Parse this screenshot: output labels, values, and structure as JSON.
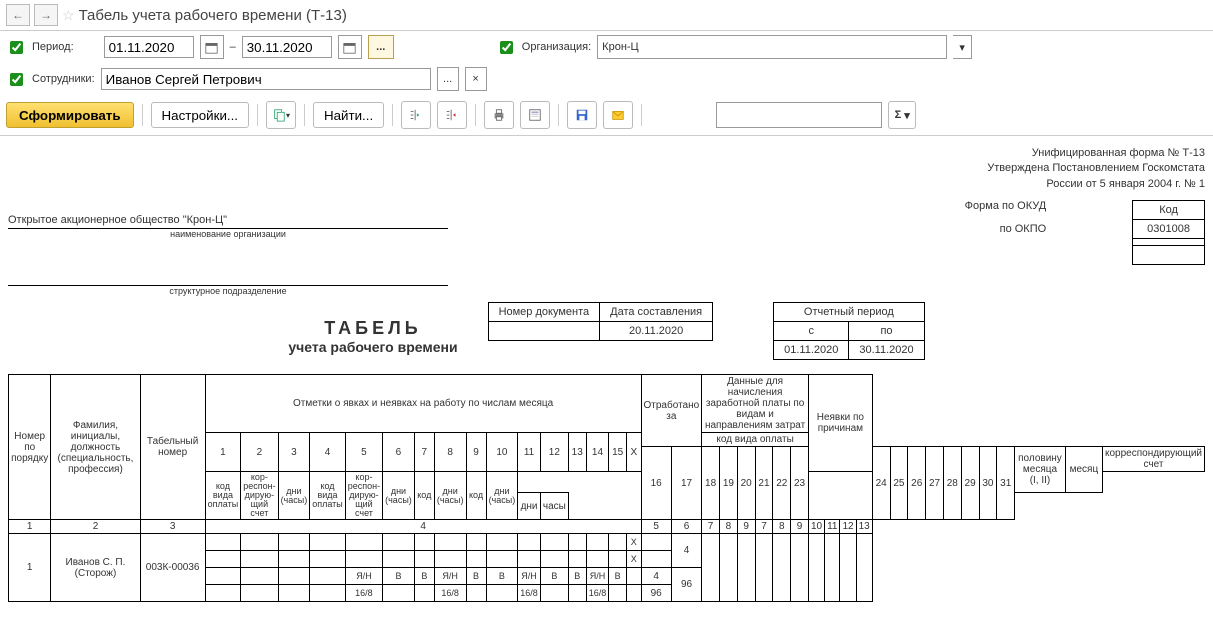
{
  "window": {
    "title": "Табель учета рабочего времени (Т-13)"
  },
  "filters": {
    "period_label": "Период:",
    "date_from": "01.11.2020",
    "date_to": "30.11.2020",
    "dash": "–",
    "org_label": "Организация:",
    "org_value": "Крон-Ц",
    "emp_label": "Сотрудники:",
    "emp_value": "Иванов Сергей Петрович"
  },
  "toolbar": {
    "generate": "Сформировать",
    "settings": "Настройки...",
    "find": "Найти...",
    "sigma": "Σ"
  },
  "report": {
    "form_hdr1": "Унифицированная форма № Т-13",
    "form_hdr2": "Утверждена Постановлением Госкомстата",
    "form_hdr3": "России от 5 января 2004 г. № 1",
    "code_label": "Код",
    "okud_label": "Форма по ОКУД",
    "okud": "0301008",
    "okpo_label": "по ОКПО",
    "okpo": "",
    "org_name": "Открытое акционерное общество \"Крон-Ц\"",
    "org_under": "наименование организации",
    "dept_under": "структурное подразделение",
    "title_big": "ТАБЕЛЬ",
    "title_sub": "учета  рабочего времени",
    "docnum_h": "Номер документа",
    "docdate_h": "Дата составления",
    "docnum": "",
    "docdate": "20.11.2020",
    "rep_period_h": "Отчетный период",
    "rep_from_h": "с",
    "rep_to_h": "по",
    "rep_from": "01.11.2020",
    "rep_to": "30.11.2020",
    "cols": {
      "c1": "Номер по порядку",
      "c2": "Фамилия, инициалы, должность (специальность, профессия)",
      "c3": "Табельный номер",
      "c4": "Отметки о явках и неявках на работу по числам месяца",
      "c5": "Отработано за",
      "c5a": "половину месяца (I, II)",
      "c5b": "месяц",
      "c5d": "дни",
      "c5h": "часы",
      "c6": "Данные для начисления заработной платы по видам и направлениям затрат",
      "c6a": "код вида оплаты",
      "c6b": "корреспондирующий счет",
      "c6c1": "код вида оплаты",
      "c6c2": "кор-респон-дирую-щий счет",
      "c6c3": "дни (часы)",
      "c7": "Неявки по причинам",
      "c7a": "код",
      "c7b": "дни (часы)",
      "n1": "1",
      "n2": "2",
      "n3": "3",
      "n4": "4",
      "n5": "5",
      "n6": "6",
      "n7": "7",
      "n8": "8",
      "n9": "9",
      "n10": "10",
      "n11": "11",
      "n12": "12",
      "n13": "13"
    },
    "days1": [
      "1",
      "2",
      "3",
      "4",
      "5",
      "6",
      "7",
      "8",
      "9",
      "10",
      "11",
      "12",
      "13",
      "14",
      "15",
      "Х"
    ],
    "days2": [
      "16",
      "17",
      "18",
      "19",
      "20",
      "21",
      "22",
      "23",
      "24",
      "25",
      "26",
      "27",
      "28",
      "29",
      "30",
      "31"
    ],
    "row": {
      "num": "1",
      "name": "Иванов С. П.",
      "pos": "(Сторож)",
      "tabnum": "003К-00036",
      "r1": [
        "",
        "",
        "",
        "",
        "",
        "",
        "",
        "",
        "",
        "",
        "",
        "",
        "",
        "",
        "",
        "Х"
      ],
      "r2": [
        "",
        "",
        "",
        "",
        "",
        "",
        "",
        "",
        "",
        "",
        "",
        "",
        "",
        "",
        "",
        "Х"
      ],
      "r3": [
        "",
        "",
        "",
        "",
        "Я/Н",
        "В",
        "В",
        "Я/Н",
        "В",
        "В",
        "Я/Н",
        "В",
        "В",
        "Я/Н",
        "В",
        ""
      ],
      "r4": [
        "",
        "",
        "",
        "",
        "16/8",
        "",
        "",
        "16/8",
        "",
        "",
        "16/8",
        "",
        "",
        "16/8",
        "",
        ""
      ],
      "half_days": "",
      "half_hours": "",
      "half2_days": "4",
      "half2_hours": "96",
      "month_days": "4",
      "month_hours": "96"
    }
  }
}
